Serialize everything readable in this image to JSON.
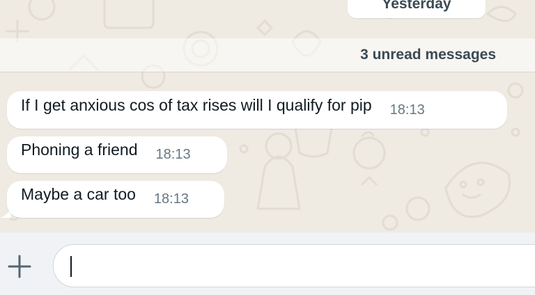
{
  "chat": {
    "date_divider": "Yesterday",
    "unread_banner": "3 unread messages",
    "messages": [
      {
        "text": "If I get anxious cos of tax rises will I qualify for pip",
        "time": "18:13"
      },
      {
        "text": "Phoning a friend",
        "time": "18:13"
      },
      {
        "text": "Maybe a car too",
        "time": "18:13"
      }
    ]
  },
  "composer": {
    "attach_icon": "plus-icon",
    "input_value": "",
    "input_placeholder": ""
  },
  "colors": {
    "chat_background": "#efeae2",
    "bubble_incoming": "#ffffff",
    "text_primary": "#111b21",
    "timestamp": "#667781"
  }
}
